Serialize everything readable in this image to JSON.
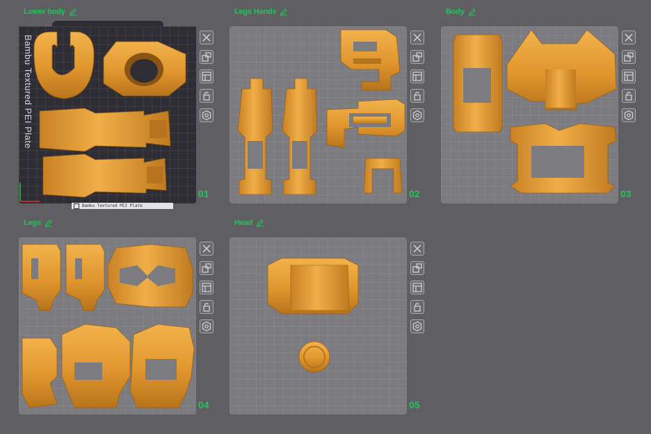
{
  "plates": [
    {
      "title": "Lower body",
      "number": "01",
      "bed_label": "Bambu Textured PEI Plate",
      "status_text": "Bambu Textured PEI Plate"
    },
    {
      "title": "Legs Hands",
      "number": "02"
    },
    {
      "title": "Body",
      "number": "03"
    },
    {
      "title": "Legs",
      "number": "04"
    },
    {
      "title": "Head",
      "number": "05"
    }
  ],
  "toolbar_buttons": [
    "close-icon",
    "auto-arrange-icon",
    "layout-icon",
    "lock-icon",
    "settings-icon"
  ],
  "colors": {
    "background": "#5f5f63",
    "accent": "#22c35a",
    "part": "#e0962e",
    "bed": "#7c7c80",
    "bed_dark": "#2d2d33"
  }
}
